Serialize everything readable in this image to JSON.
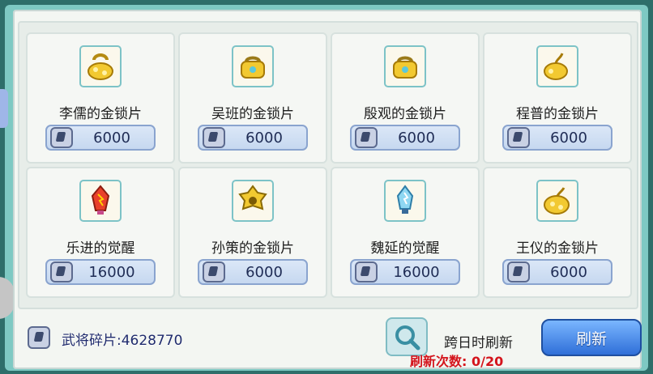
{
  "shop": {
    "items": [
      {
        "name": "李儒的金锁片",
        "price": "6000",
        "icon": "golden-lock-icon"
      },
      {
        "name": "吴班的金锁片",
        "price": "6000",
        "icon": "golden-lock-icon"
      },
      {
        "name": "殷观的金锁片",
        "price": "6000",
        "icon": "golden-lock-icon"
      },
      {
        "name": "程普的金锁片",
        "price": "6000",
        "icon": "golden-lock-icon"
      },
      {
        "name": "乐进的觉醒",
        "price": "16000",
        "icon": "awakening-gem-icon"
      },
      {
        "name": "孙策的金锁片",
        "price": "6000",
        "icon": "golden-lock-icon"
      },
      {
        "name": "魏延的觉醒",
        "price": "16000",
        "icon": "awakening-gem-icon"
      },
      {
        "name": "王仪的金锁片",
        "price": "6000",
        "icon": "golden-lock-icon"
      }
    ]
  },
  "footer": {
    "fragments_label": "武将碎片:4628770",
    "refresh_note": "跨日时刷新",
    "refresh_count": "刷新次数: 0/20",
    "refresh_button": "刷新"
  },
  "colors": {
    "accent": "#2f6fd8",
    "count_red": "#d4141c",
    "frame_teal": "#7ec9c3"
  }
}
